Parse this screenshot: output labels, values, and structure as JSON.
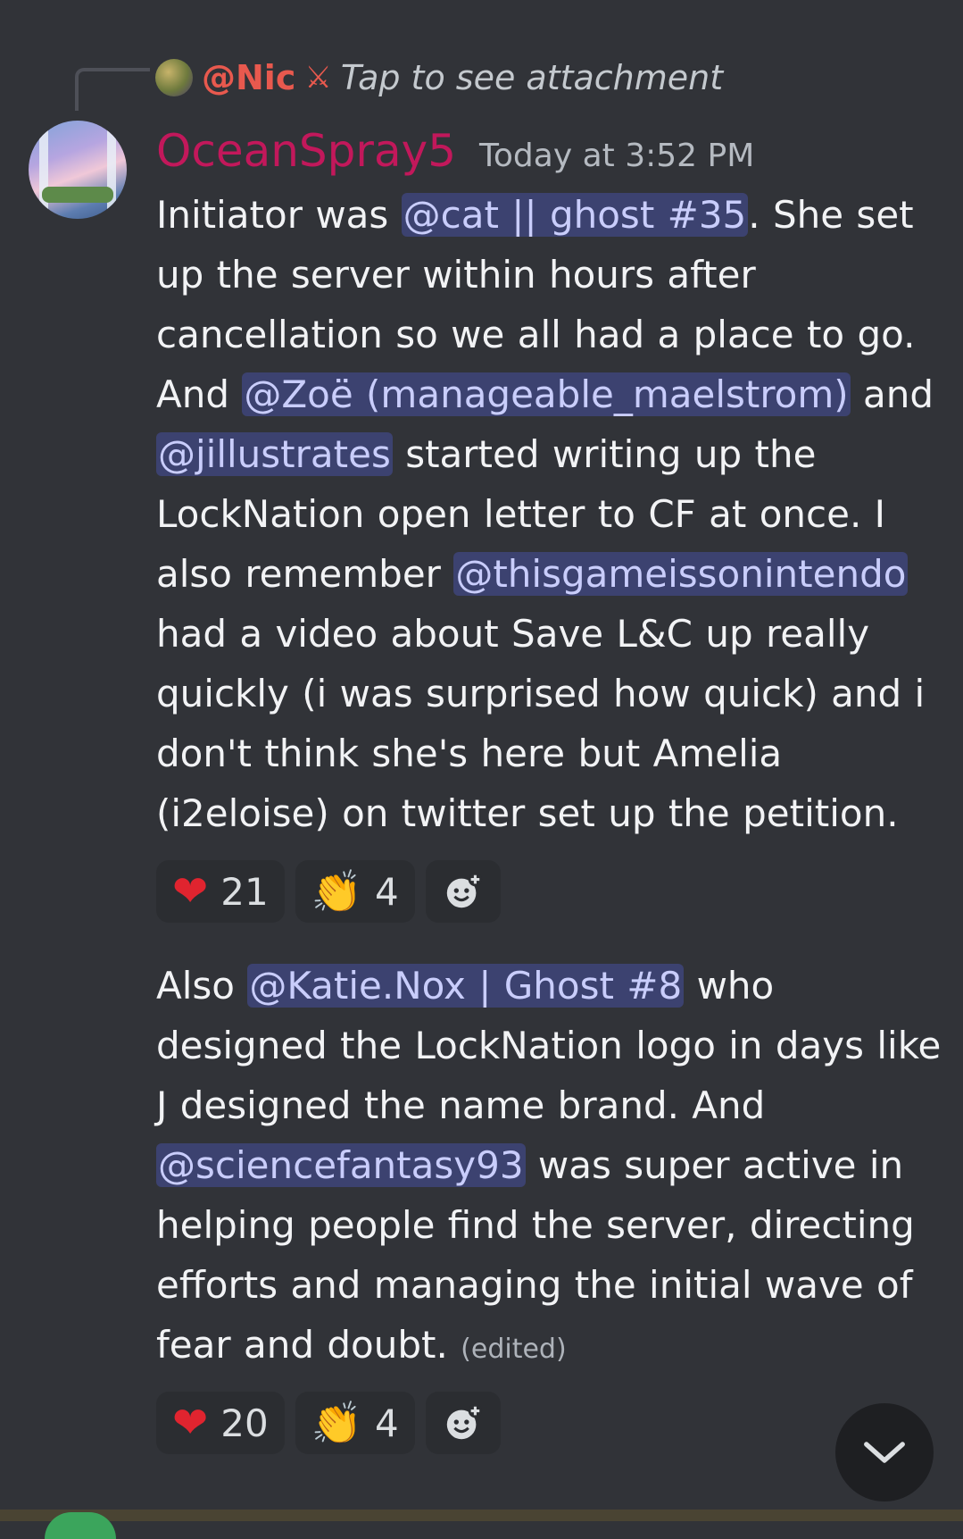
{
  "reply": {
    "name": "@Nic",
    "text": "Tap to see attachment"
  },
  "message": {
    "username": "OceanSpray5",
    "timestamp": "Today at 3:52 PM",
    "p1": {
      "t1": "Initiator was ",
      "m1": "@cat || ghost #35",
      "t2": ". She set up the server within hours after cancellation so we all had a place to go. And ",
      "m2": "@Zoë (manageable_maelstrom)",
      "t3": " and ",
      "m3": "@jillustrates",
      "t4": " started writing up the LockNation open letter to CF at once. I also remember ",
      "m4": "@thisgameissonintendo",
      "t5": " had a video about Save L&C up really quickly (i was surprised how quick) and i don't think she's here but Amelia (i2eloise) on twitter set up the petition."
    },
    "p2": {
      "t1": "Also ",
      "m1": "@Katie.Nox | Ghost #8",
      "t2": " who designed the LockNation logo in days like J designed the name brand. And ",
      "m2": "@sciencefantasy93",
      "t3": " was super active in helping people find the server, directing efforts and managing the initial wave of fear and doubt. ",
      "edited": "(edited)"
    }
  },
  "reactions1": [
    {
      "emoji": "heart",
      "glyph": "❤",
      "count": "21"
    },
    {
      "emoji": "clapping-hands",
      "glyph": "👏",
      "count": "4"
    }
  ],
  "reactions2": [
    {
      "emoji": "heart",
      "glyph": "❤",
      "count": "20"
    },
    {
      "emoji": "clapping-hands",
      "glyph": "👏",
      "count": "4"
    }
  ],
  "colors": {
    "background": "#313338",
    "username": "#c2185b",
    "mention_bg": "#3c4270",
    "mention_text": "#c9cdfb",
    "reply_name": "#e8594e"
  },
  "icons": {
    "reply_icon": "crossed-swords-icon",
    "add_reaction": "add-reaction-icon",
    "jump": "chevron-down-icon"
  }
}
